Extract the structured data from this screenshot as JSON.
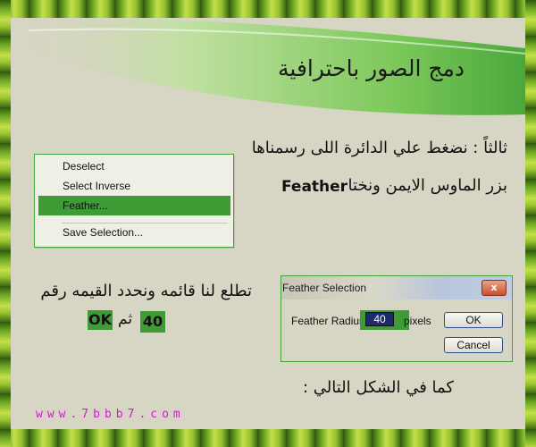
{
  "title": "دمج الصور باحترافية",
  "step": {
    "line1": "ثالثاً :  نضغط علي الدائرة اللى رسمناها",
    "line2": "بزر الماوس الايمن ونختا",
    "feather_word": "Feather"
  },
  "context_menu": {
    "items": [
      {
        "label": "Deselect"
      },
      {
        "label": "Select Inverse"
      },
      {
        "label": "Feather...",
        "selected": true
      },
      {
        "label": "Save Selection..."
      }
    ]
  },
  "instruction": {
    "line1": "تطلع لنا قائمه ونحدد القيمه رقم",
    "then_word": "ثم",
    "value": "40",
    "ok": "OK"
  },
  "dialog": {
    "title": "Feather Selection",
    "close": "x",
    "radius_label": "Feather Radius",
    "radius_value": "40",
    "unit": "pixels",
    "ok_label": "OK",
    "cancel_label": "Cancel"
  },
  "caption": "كما في الشكل التالي :",
  "footer": {
    "url": "www.7bbb7.com"
  },
  "colors": {
    "accent_green": "#3e9b35",
    "panel": "#d7d5c3",
    "url_magenta": "#d11bd1"
  }
}
